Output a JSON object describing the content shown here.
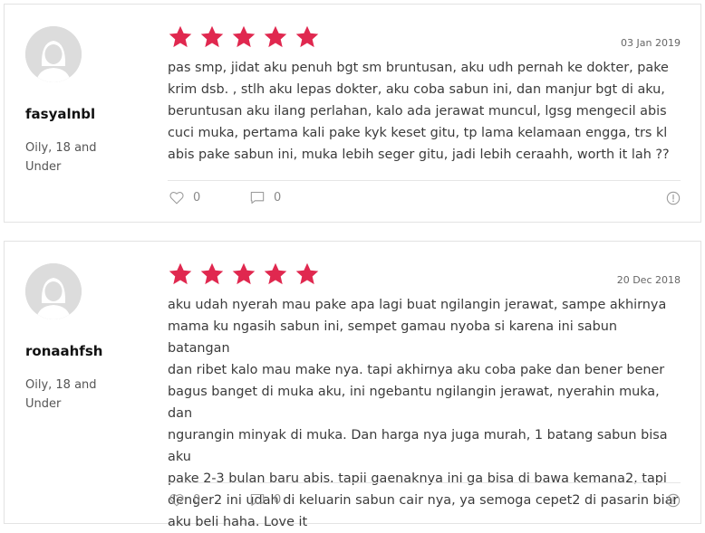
{
  "reviews": [
    {
      "username": "fasyalnbl",
      "meta": "Oily, 18 and Under",
      "rating": 5,
      "date": "03 Jan 2019",
      "text": "pas smp, jidat aku penuh bgt sm bruntusan, aku udh pernah ke dokter, pake\nkrim dsb. , stlh aku lepas dokter, aku coba sabun ini, dan manjur bgt di aku,\nberuntusan aku ilang perlahan, kalo ada jerawat muncul, lgsg mengecil abis\ncuci muka, pertama kali pake kyk keset gitu, tp lama kelamaan engga, trs kl\nabis pake sabun ini, muka lebih seger gitu, jadi lebih ceraahh, worth it lah ??",
      "likes": "0",
      "comments": "0"
    },
    {
      "username": "ronaahfsh",
      "meta": "Oily, 18 and Under",
      "rating": 5,
      "date": "20 Dec 2018",
      "text": "aku udah nyerah mau pake apa lagi buat ngilangin jerawat, sampe akhirnya\nmama ku ngasih sabun ini, sempet gamau nyoba si karena ini sabun batangan\ndan ribet kalo mau make nya. tapi akhirnya aku coba pake dan bener bener\nbagus banget di muka aku, ini ngebantu ngilangin jerawat, nyerahin muka, dan\nngurangin minyak di muka. Dan harga nya juga murah, 1 batang sabun bisa aku\npake 2-3 bulan baru abis. tapii gaenaknya ini ga bisa di bawa kemana2, tapi\ndenger2 ini udah di keluarin sabun cair nya, ya semoga cepet2 di pasarin biar\naku beli haha. Love it",
      "likes": "0",
      "comments": "0"
    }
  ],
  "colors": {
    "star": "#e0284f",
    "avatar_bg": "#dcdcdc",
    "avatar_fg": "#ffffff"
  }
}
